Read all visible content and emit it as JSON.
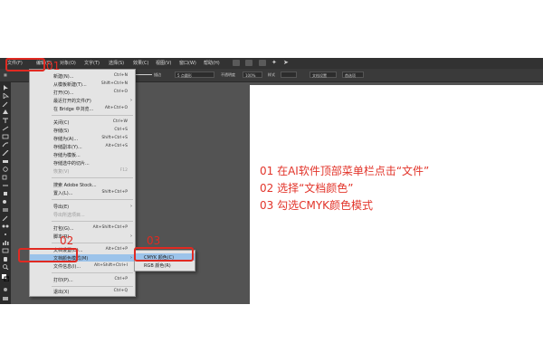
{
  "menubar": {
    "items": [
      "文件(F)",
      "编辑(E)",
      "对象(O)",
      "文字(T)",
      "选择(S)",
      "效果(C)",
      "视图(V)",
      "窗口(W)",
      "帮助(H)"
    ]
  },
  "optionsbar": {
    "stroke_value": "描边",
    "profile_label": "5 点圆形",
    "opacity_label": "不透明度",
    "opacity_value": "100%",
    "style_label": "样式",
    "doc_setup": "文档设置",
    "prefs": "首选项"
  },
  "file_menu": {
    "items": [
      {
        "label": "新建(N)...",
        "shortcut": "Ctrl+N"
      },
      {
        "label": "从模板新建(T)...",
        "shortcut": "Shift+Ctrl+N"
      },
      {
        "label": "打开(O)...",
        "shortcut": "Ctrl+O"
      },
      {
        "label": "最近打开的文件(F)",
        "shortcut": ""
      },
      {
        "label": "在 Bridge 中浏览...",
        "shortcut": "Alt+Ctrl+O"
      },
      {
        "label": "关闭(C)",
        "shortcut": "Ctrl+W"
      },
      {
        "label": "存储(S)",
        "shortcut": "Ctrl+S"
      },
      {
        "label": "存储为(A)...",
        "shortcut": "Shift+Ctrl+S"
      },
      {
        "label": "存储副本(Y)...",
        "shortcut": "Alt+Ctrl+S"
      },
      {
        "label": "存储为模板...",
        "shortcut": ""
      },
      {
        "label": "存储选中的切片...",
        "shortcut": ""
      },
      {
        "label": "恢复(V)",
        "shortcut": "F12"
      },
      {
        "label": "搜索 Adobe Stock...",
        "shortcut": ""
      },
      {
        "label": "置入(L)...",
        "shortcut": "Shift+Ctrl+P"
      },
      {
        "label": "导出(E)",
        "shortcut": ""
      },
      {
        "label": "导出所选项目...",
        "shortcut": ""
      },
      {
        "label": "打包(G)...",
        "shortcut": "Alt+Shift+Ctrl+P"
      },
      {
        "label": "脚本(R)",
        "shortcut": ""
      },
      {
        "label": "文档设置(D)...",
        "shortcut": "Alt+Ctrl+P"
      },
      {
        "label": "文档颜色模式(M)",
        "shortcut": ""
      },
      {
        "label": "文件信息(I)...",
        "shortcut": "Alt+Shift+Ctrl+I"
      },
      {
        "label": "打印(P)...",
        "shortcut": "Ctrl+P"
      },
      {
        "label": "退出(X)",
        "shortcut": "Ctrl+Q"
      }
    ]
  },
  "color_mode_submenu": {
    "items": [
      "CMYK 颜色(C)",
      "RGB 颜色(R)"
    ]
  },
  "steps": {
    "step1": "01",
    "step2": "02",
    "step3": "03"
  },
  "instructions": {
    "line1": "01 在AI软件顶部菜单栏点击“文件”",
    "line2": "02 选择“文档颜色”",
    "line3": "03 勾选CMYK颜色模式"
  },
  "colors": {
    "annotation": "#e2342a",
    "highlight": "#9cc3ea",
    "app_bg": "#3c3c3c",
    "canvas_bg": "#535353"
  }
}
